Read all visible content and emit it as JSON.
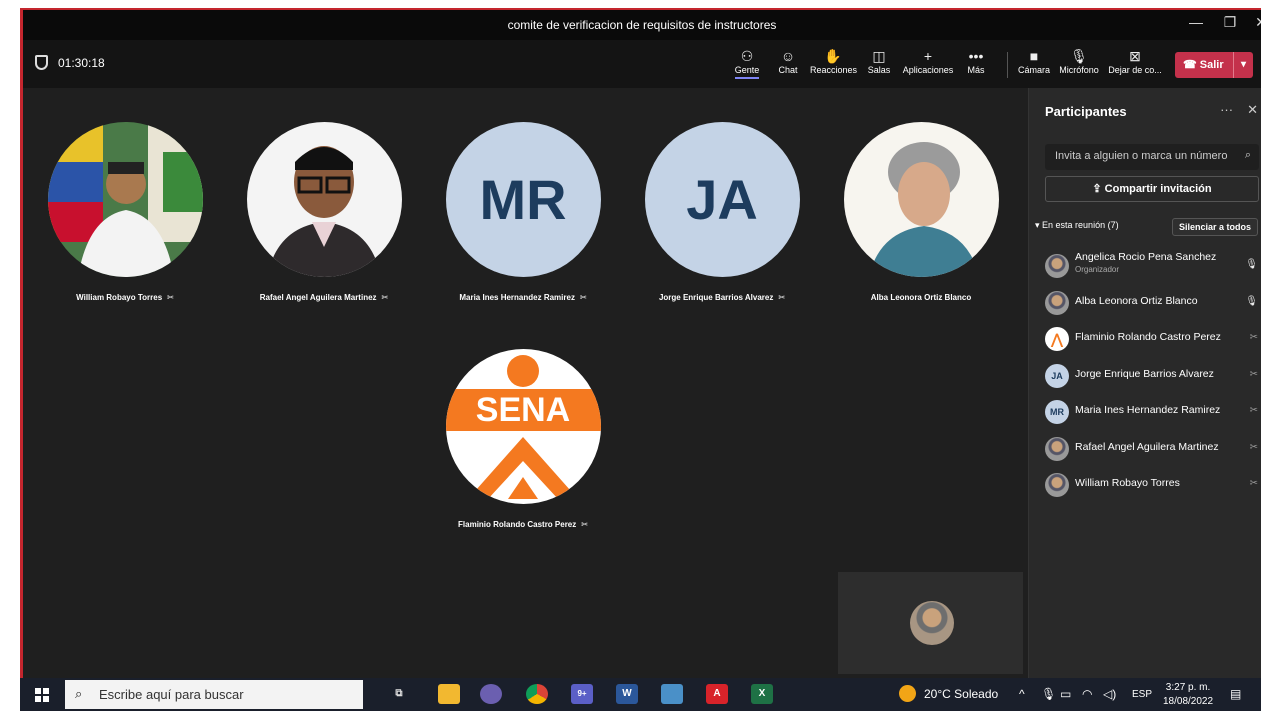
{
  "window": {
    "title": "comite de verificacion de requisitos de instructores",
    "minimize": "—",
    "maximize": "❐",
    "close": "✕"
  },
  "toolbar": {
    "timer": "01:30:18",
    "buttons": [
      {
        "label": "Gente",
        "icon": "people-icon",
        "glyph": "⚇"
      },
      {
        "label": "Chat",
        "icon": "chat-icon",
        "glyph": "☺"
      },
      {
        "label": "Reacciones",
        "icon": "hand-icon",
        "glyph": "✋"
      },
      {
        "label": "Salas",
        "icon": "rooms-icon",
        "glyph": "◫"
      },
      {
        "label": "Aplicaciones",
        "icon": "plus-icon",
        "glyph": "+"
      },
      {
        "label": "Más",
        "icon": "more-icon",
        "glyph": "•••"
      },
      {
        "label": "Cámara",
        "icon": "camera-off-icon",
        "glyph": "■"
      },
      {
        "label": "Micrófono",
        "icon": "mic-icon",
        "glyph": "🎙"
      },
      {
        "label": "Dejar de co...",
        "icon": "stop-share-icon",
        "glyph": "⊠"
      }
    ],
    "leave_label": "Salir",
    "leave_color": "#c4314b"
  },
  "stage": {
    "participants": [
      {
        "name": "William Robayo Torres",
        "type": "photo"
      },
      {
        "name": "Rafael Angel Aguilera Martinez",
        "type": "photo"
      },
      {
        "name": "Maria Ines Hernandez Ramirez",
        "type": "initials",
        "initials": "MR"
      },
      {
        "name": "Jorge Enrique Barrios Alvarez",
        "type": "initials",
        "initials": "JA"
      },
      {
        "name": "Alba Leonora Ortiz Blanco",
        "type": "photo"
      },
      {
        "name": "Flaminio Rolando Castro Perez",
        "type": "logo",
        "logo_text": "SENA"
      }
    ]
  },
  "panel": {
    "title": "Participantes",
    "search_placeholder": "Invita a alguien o marca un número",
    "share_label": "Compartir invitación",
    "section_label": "En esta reunión (7)",
    "mute_all_label": "Silenciar a todos",
    "people": [
      {
        "name": "Angelica Rocio Pena Sanchez",
        "role": "Organizador",
        "avatar": "photo",
        "mic": "on"
      },
      {
        "name": "Alba Leonora Ortiz Blanco",
        "role": "",
        "avatar": "photo",
        "mic": "on"
      },
      {
        "name": "Flaminio Rolando Castro Perez",
        "role": "",
        "avatar": "sena",
        "mic": "off"
      },
      {
        "name": "Jorge Enrique Barrios Alvarez",
        "role": "",
        "avatar": "JA",
        "mic": "off"
      },
      {
        "name": "Maria Ines Hernandez Ramirez",
        "role": "",
        "avatar": "MR",
        "mic": "off"
      },
      {
        "name": "Rafael Angel Aguilera Martinez",
        "role": "",
        "avatar": "photo",
        "mic": "off"
      },
      {
        "name": "William Robayo Torres",
        "role": "",
        "avatar": "photo",
        "mic": "off"
      }
    ]
  },
  "taskbar": {
    "search_placeholder": "Escribe aquí para buscar",
    "weather": "20°C  Soleado",
    "language": "ESP",
    "time": "3:27 p. m.",
    "date": "18/08/2022",
    "teams_badge": "9+"
  }
}
